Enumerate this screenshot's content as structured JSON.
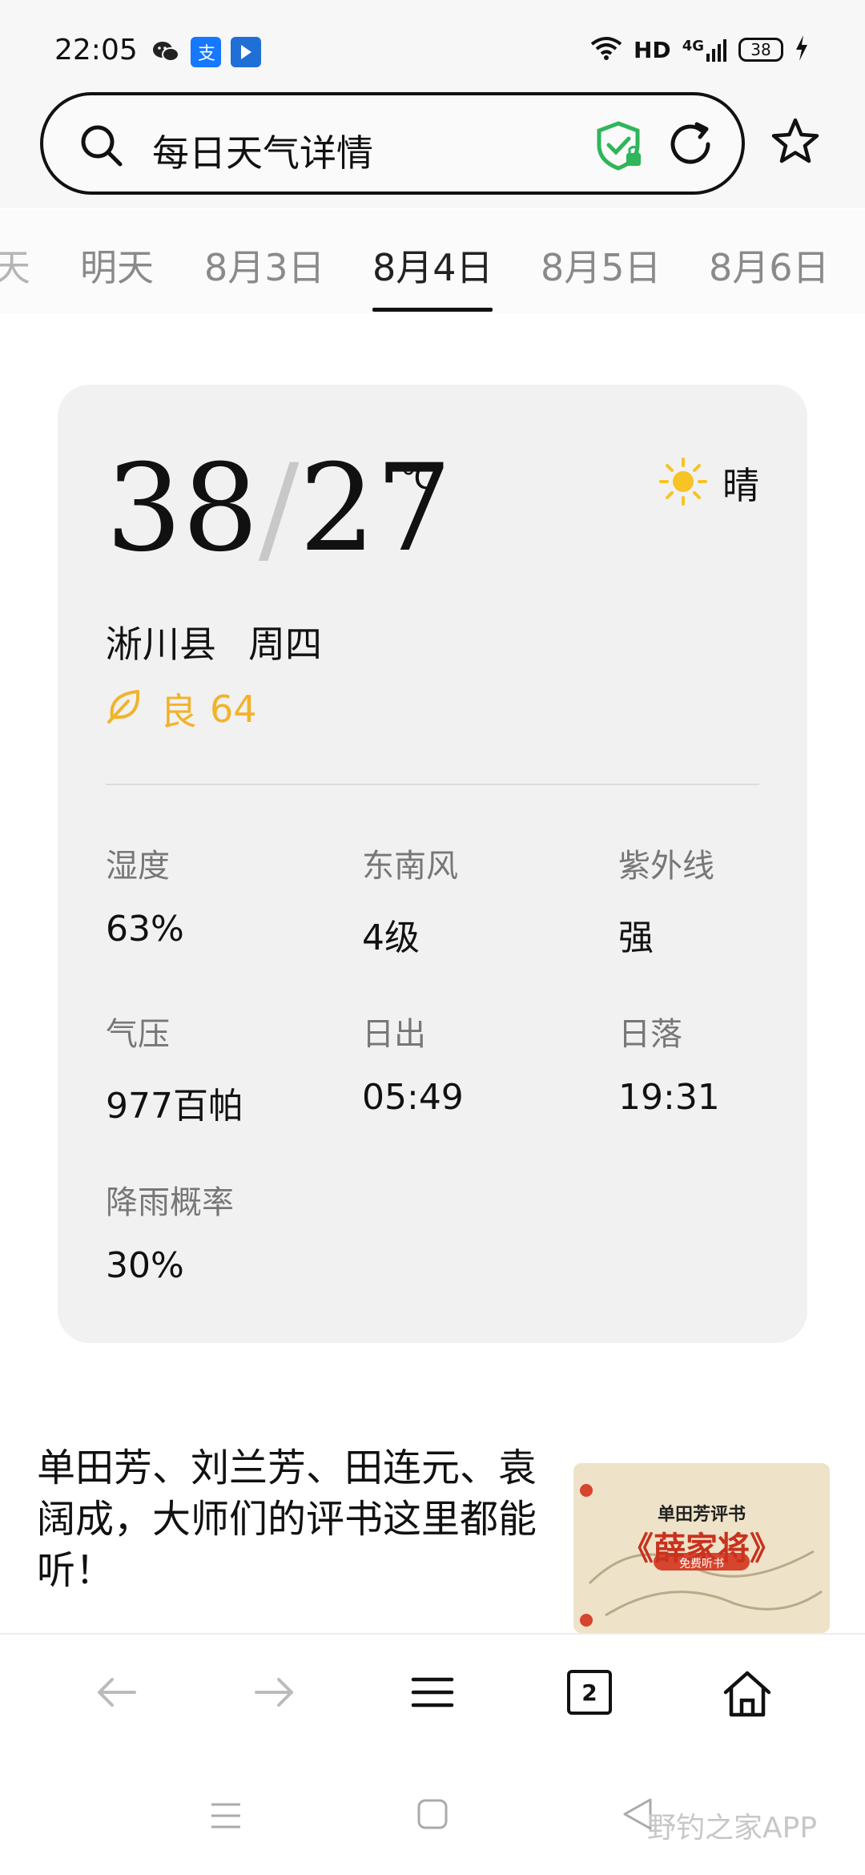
{
  "status_bar": {
    "time": "22:05",
    "network": "HD",
    "cellular": "4G",
    "battery": "38",
    "icons": [
      "wechat-icon",
      "alipay-icon",
      "app-icon",
      "wifi-icon",
      "signal-icon",
      "battery-icon",
      "charging-icon"
    ]
  },
  "search": {
    "query": "每日天气详情",
    "icons": [
      "search-icon",
      "shield-icon",
      "refresh-icon",
      "star-icon"
    ]
  },
  "tabs": {
    "items": [
      "天",
      "明天",
      "8月3日",
      "8月4日",
      "8月5日",
      "8月6日"
    ],
    "active": "8月4日"
  },
  "weather": {
    "high": "38",
    "slash": "/",
    "low": "27",
    "unit": "℃",
    "condition": "晴",
    "condition_icon": "sun-icon",
    "location": "淅川县",
    "weekday": "周四",
    "aqi_label": "良",
    "aqi_value": "64",
    "aqi_icon": "leaf-icon",
    "colors": {
      "aqi": "#f1b32a",
      "sun": "#f7c325",
      "card_bg": "#f1f1f1"
    },
    "metrics": [
      {
        "label": "湿度",
        "value": "63%"
      },
      {
        "label": "东南风",
        "value": "4级"
      },
      {
        "label": "紫外线",
        "value": "强"
      },
      {
        "label": "气压",
        "value": "977百帕"
      },
      {
        "label": "日出",
        "value": "05:49"
      },
      {
        "label": "日落",
        "value": "19:31"
      },
      {
        "label": "降雨概率",
        "value": "30%"
      }
    ]
  },
  "news": {
    "text": "单田芳、刘兰芳、田连元、袁阔成，大师们的评书这里都能听！",
    "thumb_small": "单田芳评书",
    "thumb_title": "《薛家将》",
    "thumb_badge": "免费听书"
  },
  "bottom_bar": {
    "tab_count": "2",
    "icons": [
      "back-icon",
      "forward-icon",
      "menu-icon",
      "tabs-icon",
      "home-icon"
    ]
  },
  "system_nav": {
    "watermark": "野钓之家APP"
  }
}
